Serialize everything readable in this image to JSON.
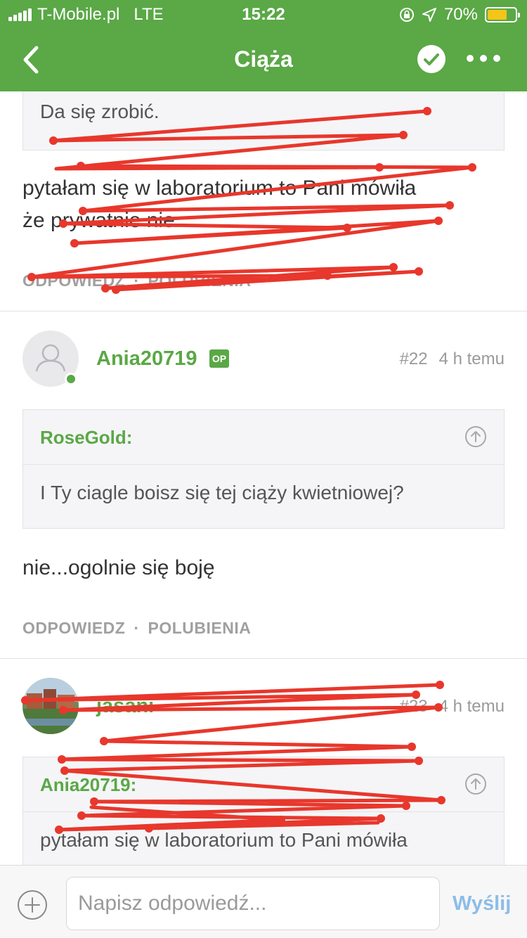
{
  "status_bar": {
    "carrier": "T-Mobile.pl",
    "network": "LTE",
    "time": "15:22",
    "battery": "70%",
    "battery_level": 0.7,
    "battery_color": "#f5c518"
  },
  "nav": {
    "title": "Ciąża",
    "back_icon": "chevron-left-icon",
    "check_icon": "check-circle-icon",
    "more_icon": "ellipsis-icon"
  },
  "theme": {
    "accent": "#5aa846",
    "scribble": "#e8372c"
  },
  "posts": [
    {
      "quote": {
        "text": "Da się zrobić."
      },
      "text_line1": "pytałam się w laboratorium to Pani mówiła",
      "text_line2": "że prywatnie nie",
      "reply": "ODPOWIEDZ",
      "separator": "·",
      "likes": "POLUBIENIA"
    },
    {
      "author": "Ania20719",
      "badge": "OP",
      "number": "#22",
      "time": "4 h temu",
      "quote": {
        "author": "RoseGold:",
        "text": "I Ty ciagle boisz się tej ciąży kwietniowej?"
      },
      "text": "nie...ogolnie się boję",
      "reply": "ODPOWIEDZ",
      "separator": "·",
      "likes": "POLUBIENIA"
    },
    {
      "author": "jasani",
      "number": "#23",
      "time": "4 h temu",
      "quote": {
        "author": "Ania20719:",
        "text": "pytałam się w laboratorium to Pani mówiła"
      }
    }
  ],
  "compose": {
    "placeholder": "Napisz odpowiedź...",
    "send": "Wyślij",
    "add_icon": "plus-circle-icon"
  }
}
